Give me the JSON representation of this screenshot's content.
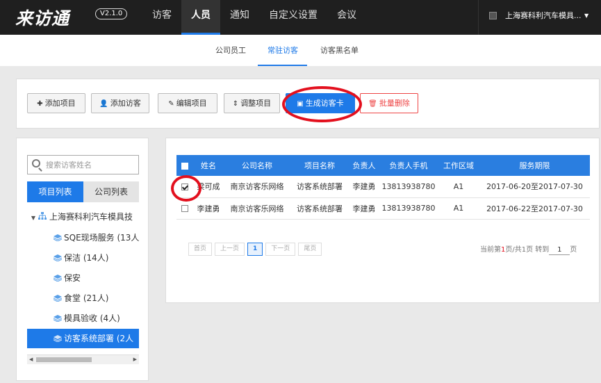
{
  "app": {
    "logo": "来访通",
    "version": "V2.1.0"
  },
  "nav": {
    "items": [
      "访客",
      "人员",
      "通知",
      "自定义设置",
      "会议"
    ]
  },
  "company": {
    "name": "上海赛科利汽车模具...",
    "caret": "▼"
  },
  "subnav": {
    "tabs": [
      "公司员工",
      "常驻访客",
      "访客黑名单"
    ]
  },
  "toolbar": {
    "add_project": "添加项目",
    "add_visitor": "添加访客",
    "edit_project": "编辑项目",
    "adjust_project": "调整项目",
    "generate_card": "生成访客卡",
    "batch_delete": "批量删除"
  },
  "left": {
    "search_placeholder": "搜索访客姓名",
    "tab_projects": "项目列表",
    "tab_companies": "公司列表",
    "tree_root": "上海赛科利汽车模具技",
    "tree_items": [
      "SQE现场服务 (13人",
      "保洁 (14人)",
      "保安",
      "食堂 (21人)",
      "模具验收 (4人)",
      "访客系统部署 (2人"
    ]
  },
  "table": {
    "headers": [
      "姓名",
      "公司名称",
      "项目名称",
      "负责人",
      "负责人手机",
      "工作区域",
      "服务期限"
    ],
    "rows": [
      {
        "checked": true,
        "cells": [
          "梁可成",
          "南京访客乐网络",
          "访客系统部署",
          "李建勇",
          "13813938780",
          "A1",
          "2017-06-20至2017-07-30"
        ]
      },
      {
        "checked": false,
        "cells": [
          "李建勇",
          "南京访客乐网络",
          "访客系统部署",
          "李建勇",
          "13813938780",
          "A1",
          "2017-06-22至2017-07-30"
        ]
      }
    ]
  },
  "pager": {
    "first": "首页",
    "prev": "上一页",
    "current": "1",
    "next": "下一页",
    "last": "尾页",
    "info_prefix": "当前第",
    "page": "1",
    "info_mid": "页/共1页 转到",
    "goto_value": "1",
    "info_suffix": "页"
  },
  "colors": {
    "accent": "#1e7ae8",
    "annotation_ring": "#e3101e",
    "danger": "#e44444",
    "topbar": "#1f1f1f"
  }
}
